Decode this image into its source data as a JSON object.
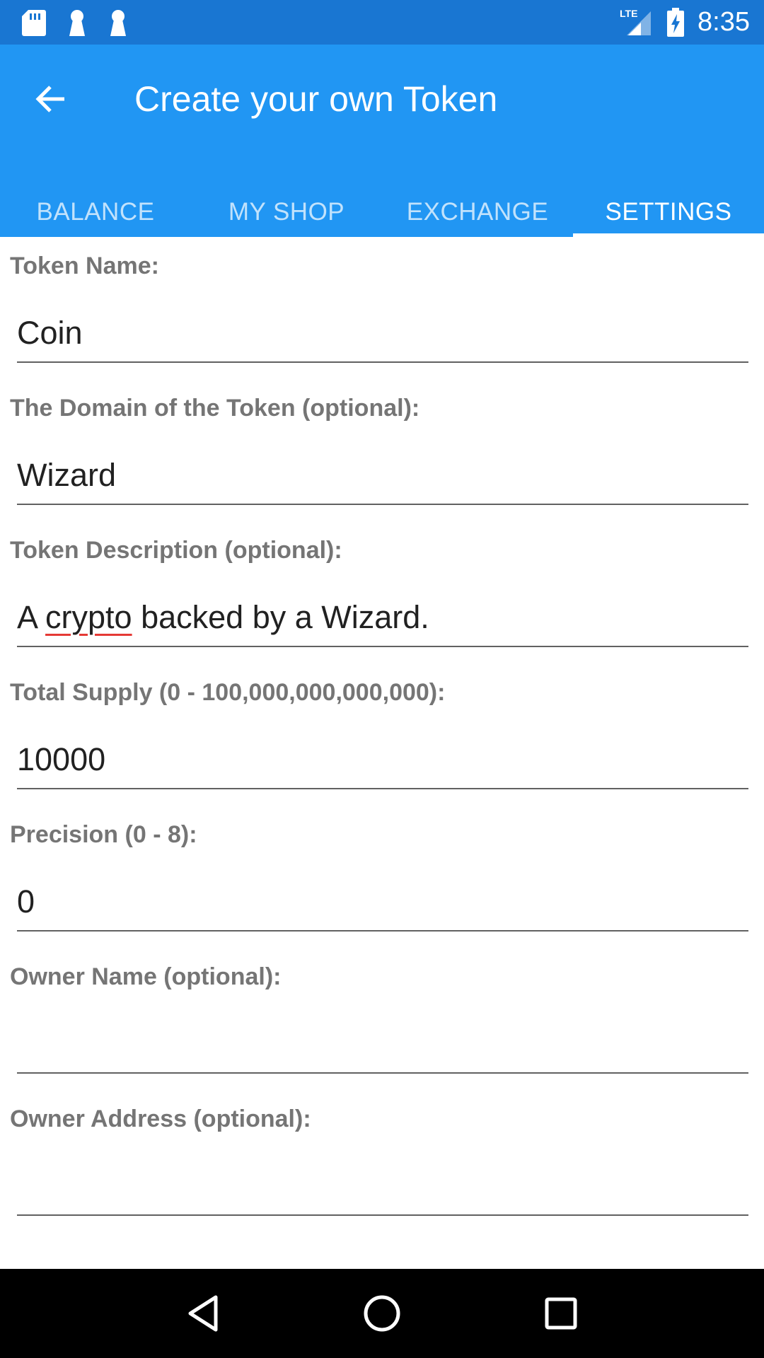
{
  "status_bar": {
    "time": "8:35",
    "network": "LTE",
    "left_icons": [
      "sd-card-icon",
      "keyhole-icon",
      "keyhole-icon"
    ],
    "right_icons": [
      "signal-icon",
      "battery-charging-icon"
    ],
    "color": "#1976D2"
  },
  "app_bar": {
    "title": "Create your own Token",
    "color": "#2196F3",
    "tabs": [
      {
        "label": "BALANCE",
        "active": false
      },
      {
        "label": "MY SHOP",
        "active": false
      },
      {
        "label": "EXCHANGE",
        "active": false
      },
      {
        "label": "SETTINGS",
        "active": true
      }
    ]
  },
  "form": {
    "fields": [
      {
        "label": "Token Name:",
        "value": ""
      },
      {
        "label": "The Domain of the Token (optional):",
        "value": "Wizard"
      },
      {
        "label": "Token Description (optional):",
        "value_parts": [
          "A ",
          "crypto",
          " backed by a Wizard."
        ]
      },
      {
        "label": "Total Supply (0 - 100,000,000,000,000):",
        "value": "10000"
      },
      {
        "label": "Precision (0 - 8):",
        "value": "0"
      },
      {
        "label": "Owner Name (optional):",
        "value": ""
      },
      {
        "label": "Owner Address (optional):",
        "value": ""
      }
    ],
    "token_name_value": "Coin"
  },
  "nav_bar": {
    "buttons": [
      "back-triangle-icon",
      "home-circle-icon",
      "recents-square-icon"
    ]
  }
}
